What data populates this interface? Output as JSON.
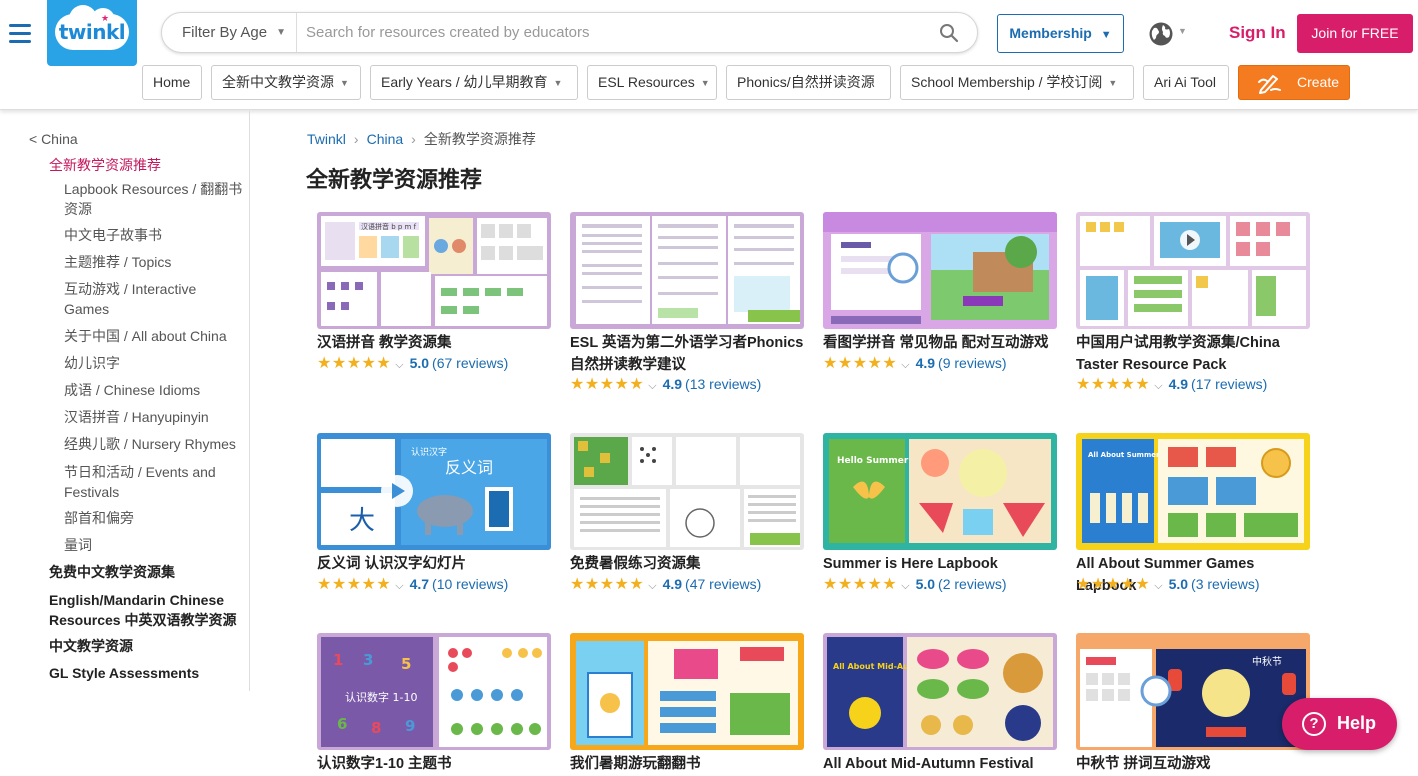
{
  "header": {
    "logo_text": "twinkl",
    "age_filter_label": "Filter By Age",
    "search_placeholder": "Search for resources created by educators",
    "membership_label": "Membership",
    "signin_label": "Sign In",
    "join_label": "Join for FREE"
  },
  "nav": [
    {
      "label": "Home",
      "dropdown": false
    },
    {
      "label": "全新中文教学资源",
      "dropdown": true
    },
    {
      "label": "Early Years / 幼儿早期教育",
      "dropdown": true
    },
    {
      "label": "ESL Resources",
      "dropdown": true
    },
    {
      "label": "Phonics/自然拼读资源",
      "dropdown": false
    },
    {
      "label": "School Membership / 学校订阅",
      "dropdown": true
    },
    {
      "label": "Ari Ai Tool",
      "dropdown": false
    }
  ],
  "create_label": "Create",
  "sidebar": {
    "back": "< China",
    "active": "全新教学资源推荐",
    "sub_items": [
      "Lapbook Resources / 翻翻书资源",
      "中文电子故事书",
      "主题推荐 / Topics",
      "互动游戏 / Interactive Games",
      "关于中国 / All about China",
      "幼儿识字",
      "成语 / Chinese Idioms",
      "汉语拼音 / Hanyupinyin",
      "经典儿歌 / Nursery Rhymes",
      "节日和活动 / Events and Festivals",
      "部首和偏旁",
      "量词"
    ],
    "sections": [
      "免费中文教学资源集",
      "English/Mandarin Chinese Resources 中英双语教学资源",
      "中文教学资源",
      "GL Style Assessments"
    ]
  },
  "breadcrumb": {
    "items": [
      "Twinkl",
      "China"
    ],
    "current": "全新教学资源推荐"
  },
  "page_title": "全新教学资源推荐",
  "stars_glyph": "★★★★★",
  "cards": [
    {
      "title": "汉语拼音 教学资源集",
      "score": "5.0",
      "reviews": "(67 reviews)"
    },
    {
      "title": "ESL 英语为第二外语学习者Phonics自然拼读教学建议",
      "score": "4.9",
      "reviews": "(13 reviews)"
    },
    {
      "title": "看图学拼音 常见物品 配对互动游戏",
      "score": "4.9",
      "reviews": "(9 reviews)"
    },
    {
      "title": "中国用户试用教学资源集/China Taster Resource Pack",
      "score": "4.9",
      "reviews": "(17 reviews)"
    },
    {
      "title": "反义词 认识汉字幻灯片",
      "score": "4.7",
      "reviews": "(10 reviews)"
    },
    {
      "title": "免费暑假练习资源集",
      "score": "4.9",
      "reviews": "(47 reviews)"
    },
    {
      "title": "Summer is Here Lapbook",
      "score": "5.0",
      "reviews": "(2 reviews)"
    },
    {
      "title": "All About Summer Games Lapbook",
      "score": "5.0",
      "reviews": "(3 reviews)"
    },
    {
      "title": "认识数字1-10 主题书",
      "score": "",
      "reviews": ""
    },
    {
      "title": "我们暑期游玩翻翻书",
      "score": "",
      "reviews": ""
    },
    {
      "title": "All About Mid-Autumn Festival",
      "score": "",
      "reviews": ""
    },
    {
      "title": "中秋节 拼词互动游戏",
      "score": "",
      "reviews": ""
    }
  ],
  "thumb_text": {
    "t1_label": "汉语拼音 b p m f",
    "t5_title": "认识汉字",
    "t5_word": "反义词",
    "t5_char": "大",
    "t7_label": "Hello Summer",
    "t8_label": "All About Summer Games",
    "t9_label": "认识数字 1-10",
    "t11_label": "All About Mid-Autumn Festival",
    "t12_label": "中秋节"
  },
  "help_label": "Help",
  "colors": {
    "brand_pink": "#d81e6a",
    "brand_blue": "#1b6cb0",
    "create_orange": "#f47b20",
    "star": "#f2b01e"
  }
}
